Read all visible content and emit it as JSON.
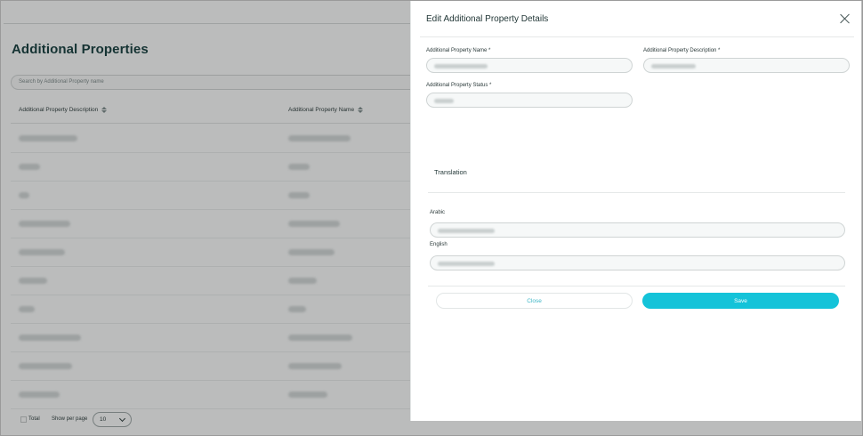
{
  "background_page": {
    "title": "Additional Properties",
    "search_placeholder": "Search by Additional Property name",
    "columns": [
      "Additional Property Description",
      "Additional Property Name"
    ],
    "rows": [
      {
        "desc_len": 66,
        "name_len": 70
      },
      {
        "desc_len": 24,
        "name_len": 24
      },
      {
        "desc_len": 12,
        "name_len": 24
      },
      {
        "desc_len": 58,
        "name_len": 58
      },
      {
        "desc_len": 52,
        "name_len": 52
      },
      {
        "desc_len": 32,
        "name_len": 32
      },
      {
        "desc_len": 18,
        "name_len": 20
      },
      {
        "desc_len": 70,
        "name_len": 72
      },
      {
        "desc_len": 60,
        "name_len": 60
      },
      {
        "desc_len": 46,
        "name_len": 44
      }
    ],
    "footer": {
      "total_label": "Total",
      "show_per_page_label": "Show per page",
      "per_page_value": "10"
    }
  },
  "modal": {
    "title": "Edit Additional Property Details",
    "fields": {
      "name_label": "Additional Property Name",
      "description_label": "Additional Property Description",
      "status_label": "Additional Property Status",
      "required_mark": "*"
    },
    "translation": {
      "heading": "Translation",
      "arabic_label": "Arabic",
      "english_label": "English"
    },
    "buttons": {
      "close_label": "Close",
      "save_label": "Save"
    }
  },
  "colors": {
    "accent": "#14c3d9",
    "overlay": "rgba(30,32,32,0.3)",
    "title_text": "#123c3c"
  },
  "icons": {
    "close": "close-icon",
    "sort": "sort-icon",
    "chevron": "chevron-down-icon"
  }
}
